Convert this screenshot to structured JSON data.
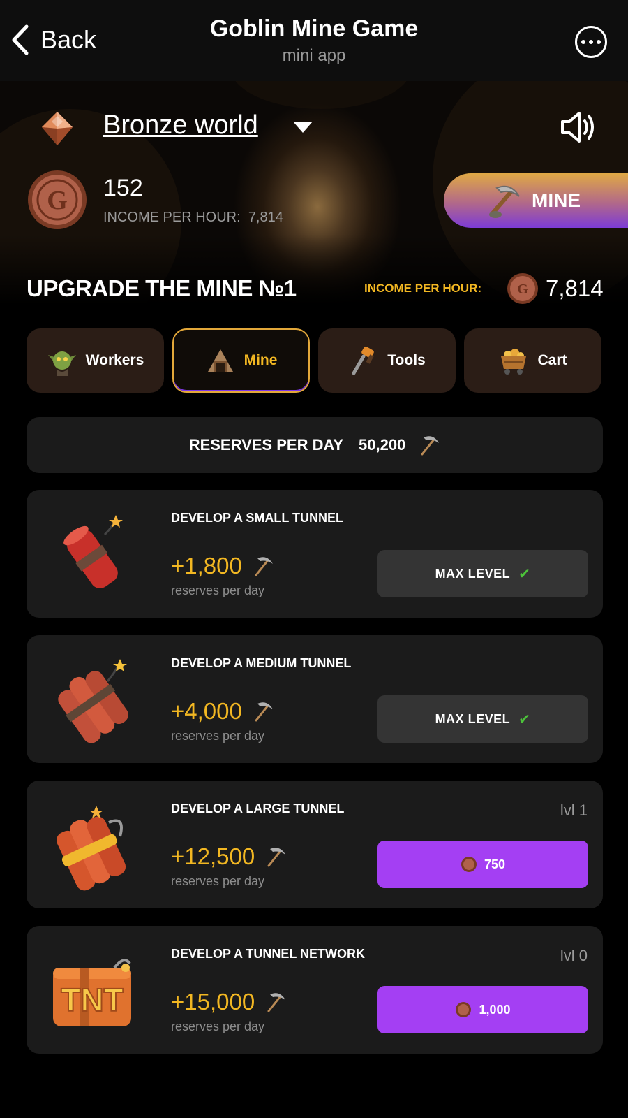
{
  "header": {
    "back_label": "Back",
    "title": "Goblin Mine Game",
    "subtitle": "mini app"
  },
  "world": {
    "name": "Bronze world"
  },
  "balance": {
    "amount": "152",
    "income_label": "INCOME PER HOUR:",
    "income_value": "7,814"
  },
  "mine_button": {
    "label": "MINE"
  },
  "upgrade": {
    "title": "UPGRADE THE MINE №1",
    "income_label": "INCOME PER HOUR:",
    "income_value": "7,814"
  },
  "tabs": [
    {
      "label": "Workers",
      "icon": "goblin-icon",
      "active": false
    },
    {
      "label": "Mine",
      "icon": "mine-icon",
      "active": true
    },
    {
      "label": "Tools",
      "icon": "drill-icon",
      "active": false
    },
    {
      "label": "Cart",
      "icon": "mine-cart-icon",
      "active": false
    }
  ],
  "reserves": {
    "label": "RESERVES PER DAY",
    "value": "50,200"
  },
  "cards": [
    {
      "title": "DEVELOP A SMALL TUNNEL",
      "level": "",
      "amount": "+1,800",
      "unit": "reserves per day",
      "button": "MAX LEVEL",
      "state": "max",
      "icon": "small-dynamite-icon"
    },
    {
      "title": "DEVELOP A MEDIUM TUNNEL",
      "level": "",
      "amount": "+4,000",
      "unit": "reserves per day",
      "button": "MAX LEVEL",
      "state": "max",
      "icon": "dynamite-bundle-icon"
    },
    {
      "title": "DEVELOP A LARGE TUNNEL",
      "level": "lvl 1",
      "amount": "+12,500",
      "unit": "reserves per day",
      "button": "750",
      "state": "buy",
      "icon": "large-dynamite-icon"
    },
    {
      "title": "DEVELOP A TUNNEL NETWORK",
      "level": "lvl 0",
      "amount": "+15,000",
      "unit": "reserves per day",
      "button": "1,000",
      "state": "buy",
      "icon": "tnt-box-icon"
    }
  ],
  "colors": {
    "accent_gold": "#f2b722",
    "accent_purple": "#a43ff3",
    "card_bg": "#1b1b1b",
    "tab_bg": "#2b1d16",
    "check_green": "#4cc23a"
  }
}
